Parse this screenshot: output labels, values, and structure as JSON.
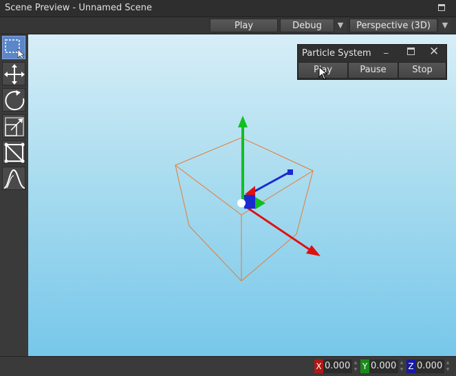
{
  "window": {
    "title": "Scene Preview - Unnamed Scene"
  },
  "toolbar": {
    "play_label": "Play",
    "debug_label": "Debug",
    "perspective_label": "Perspective (3D)"
  },
  "tools": [
    {
      "name": "select-tool-icon",
      "active": true
    },
    {
      "name": "move-tool-icon",
      "active": false
    },
    {
      "name": "rotate-tool-icon",
      "active": false
    },
    {
      "name": "scale-tool-icon",
      "active": false
    },
    {
      "name": "rect-transform-tool-icon",
      "active": false
    },
    {
      "name": "curve-tool-icon",
      "active": false
    }
  ],
  "particle_system": {
    "title": "Particle System",
    "play_label": "Play",
    "pause_label": "Pause",
    "stop_label": "Stop"
  },
  "coords": {
    "x_label": "X",
    "x_value": "0.000",
    "y_label": "Y",
    "y_value": "0.000",
    "z_label": "Z",
    "z_value": "0.000"
  },
  "colors": {
    "accent": "#5b87c8",
    "axis_x": "#e01010",
    "axis_y": "#10c020",
    "axis_z": "#1a2ad0",
    "bounds": "#e87a30",
    "x_tag": "#b01818",
    "y_tag": "#1a8a1a",
    "z_tag": "#1a1aa0"
  }
}
